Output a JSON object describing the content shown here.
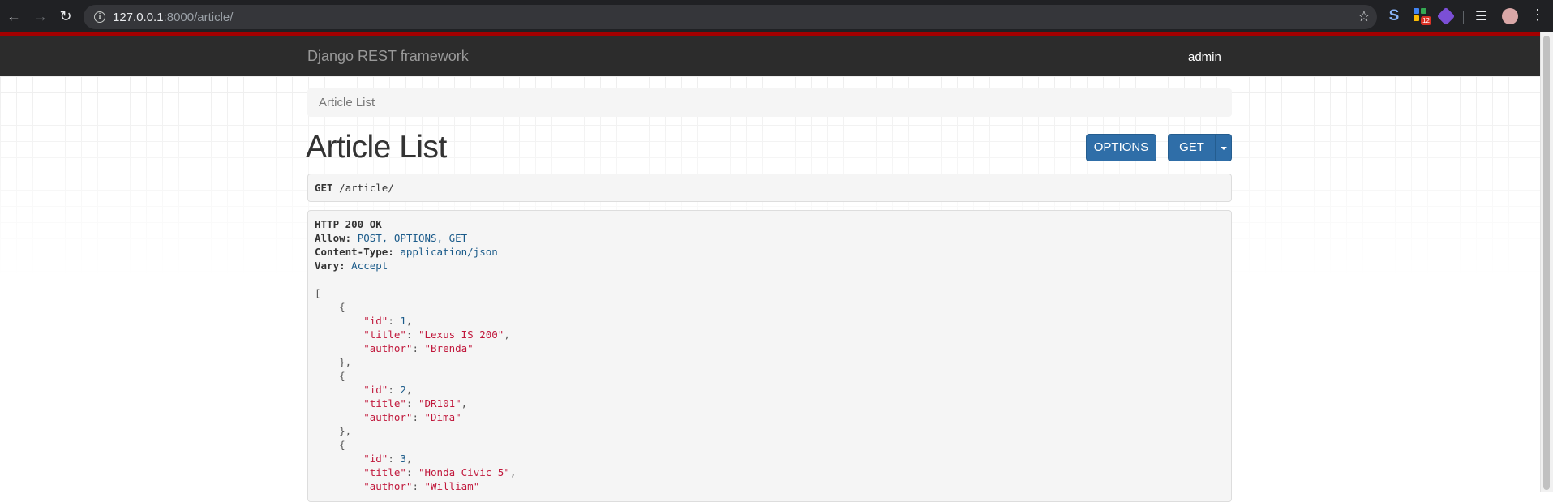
{
  "browser": {
    "url_host": "127.0.0.1",
    "url_rest": ":8000/article/",
    "extension_badge": "12",
    "colors": {
      "chrome_bg": "#202124",
      "omnibox_bg": "#35363a"
    }
  },
  "navbar": {
    "brand": "Django REST framework",
    "user": "admin",
    "colors": {
      "bg": "#2c2c2c",
      "accent_border": "#a30000"
    }
  },
  "breadcrumb": {
    "label": "Article List"
  },
  "page": {
    "title": "Article List",
    "options_label": "OPTIONS",
    "get_label": "GET",
    "button_color": "#2f6ea8"
  },
  "request": {
    "method": "GET",
    "path": "/article/"
  },
  "response": {
    "status": "HTTP 200 OK",
    "headers": [
      {
        "name": "Allow:",
        "value": "POST, OPTIONS, GET"
      },
      {
        "name": "Content-Type:",
        "value": "application/json"
      },
      {
        "name": "Vary:",
        "value": "Accept"
      }
    ],
    "articles": [
      {
        "id": "1",
        "title": "\"Lexus IS 200\"",
        "author": "\"Brenda\""
      },
      {
        "id": "2",
        "title": "\"DR101\"",
        "author": "\"Dima\""
      },
      {
        "id": "3",
        "title": "\"Honda Civic 5\"",
        "author": "\"William\""
      }
    ],
    "keys": {
      "id": "\"id\"",
      "title": "\"title\"",
      "author": "\"author\""
    }
  }
}
